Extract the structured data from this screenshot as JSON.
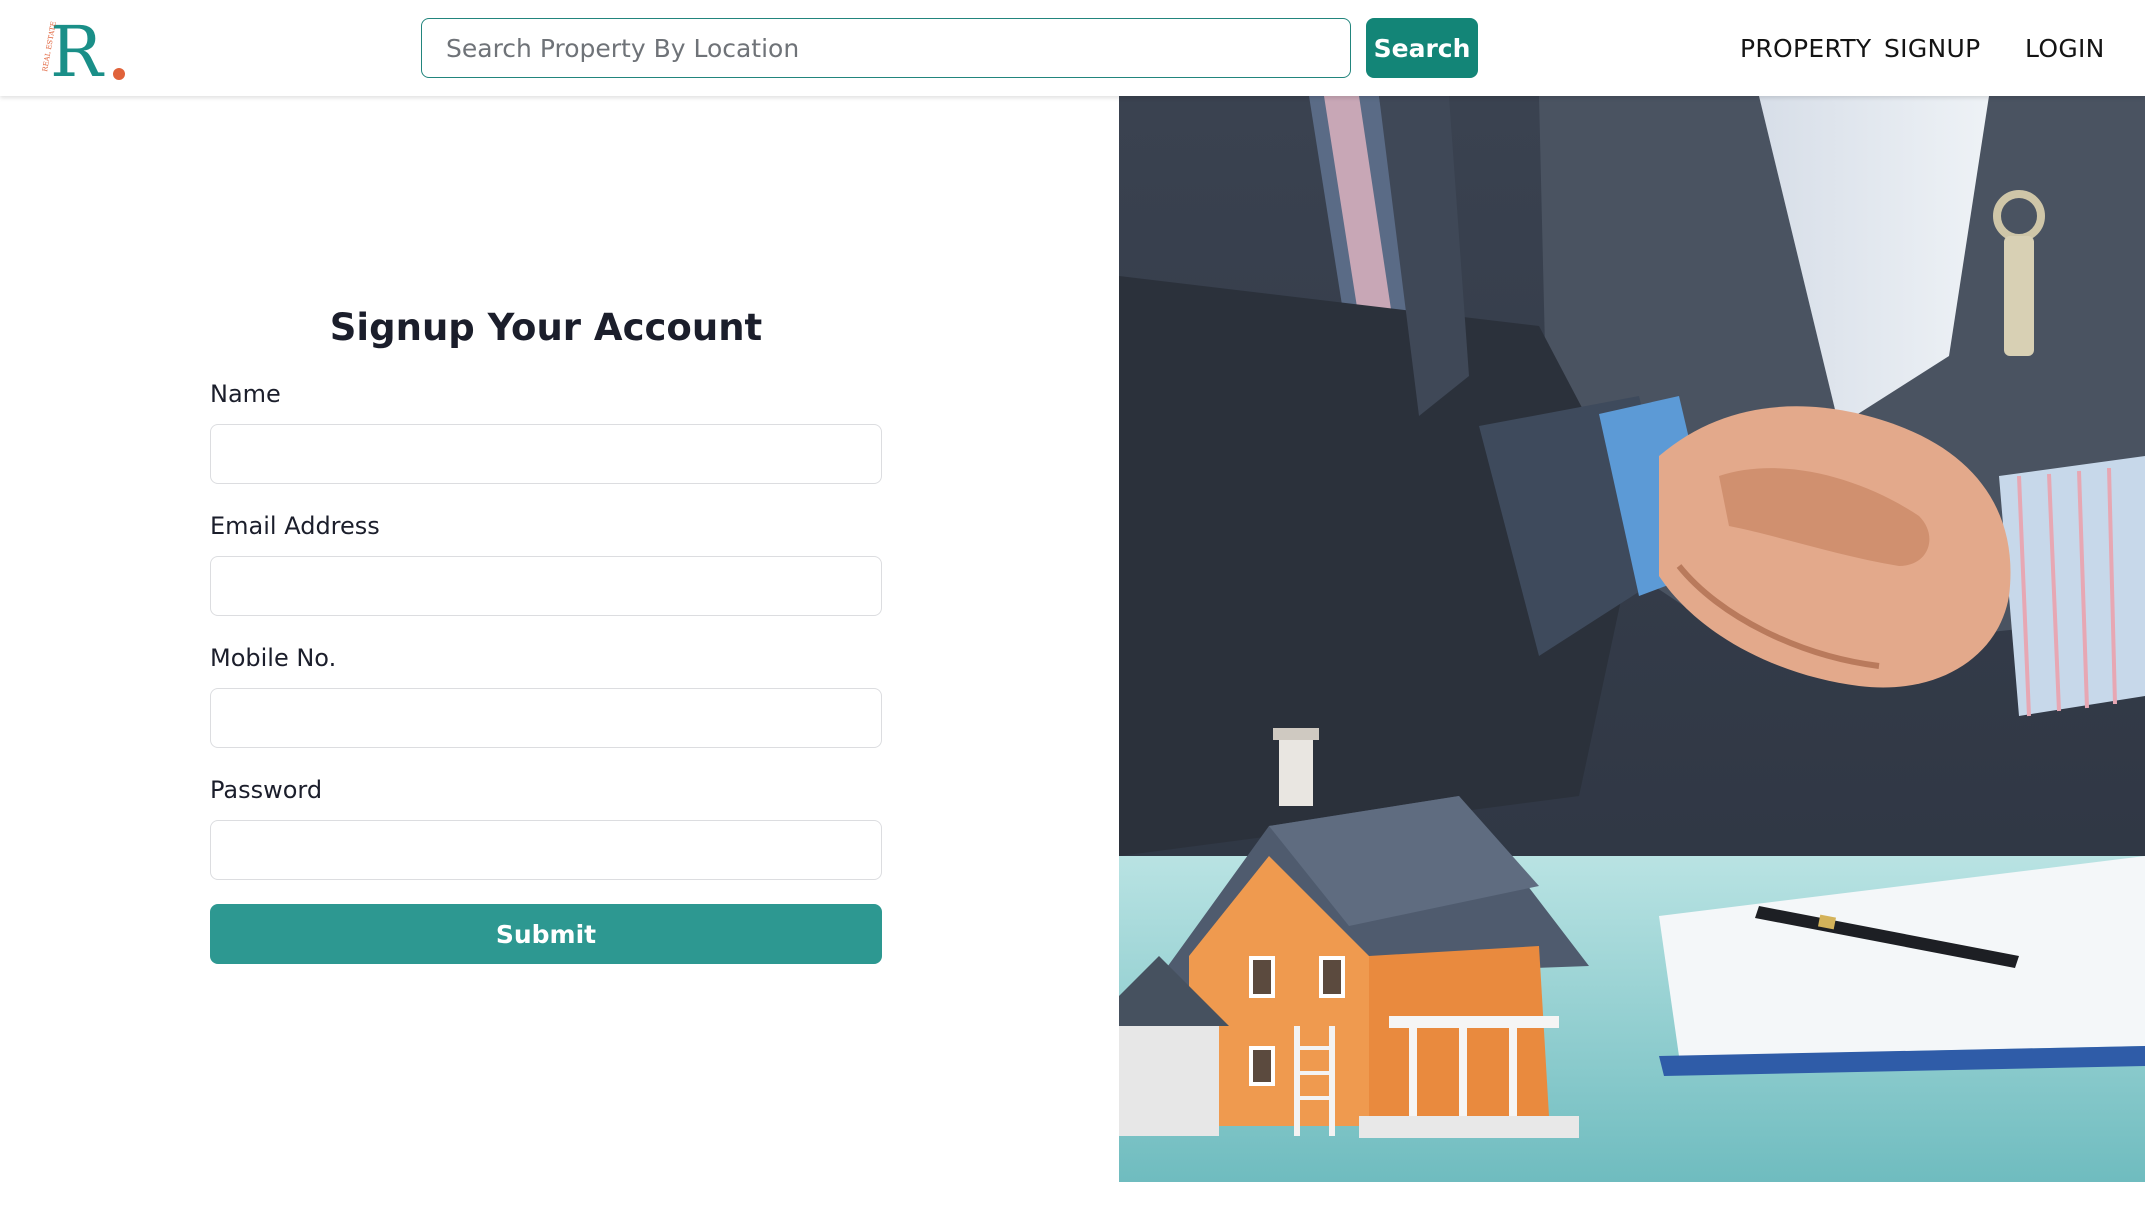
{
  "header": {
    "logo": {
      "letter": "R",
      "tagline": "REAL ESTATE",
      "accent_color": "#1a8f88",
      "dot_color": "#e0623a"
    },
    "search": {
      "placeholder": "Search Property By Location",
      "value": "",
      "button_label": "Search"
    },
    "nav": {
      "property": "PROPERTY",
      "signup": "SIGNUP",
      "login": "LOGIN"
    }
  },
  "form": {
    "title": "Signup Your Account",
    "fields": {
      "name": {
        "label": "Name",
        "value": ""
      },
      "email": {
        "label": "Email Address",
        "value": ""
      },
      "mobile": {
        "label": "Mobile No.",
        "value": ""
      },
      "password": {
        "label": "Password",
        "value": ""
      }
    },
    "submit_label": "Submit"
  },
  "hero": {
    "image_subject": "business-handshake-with-model-house-and-keys"
  },
  "colors": {
    "primary": "#138577",
    "submit": "#2d9891",
    "text": "#1b1e2b"
  }
}
